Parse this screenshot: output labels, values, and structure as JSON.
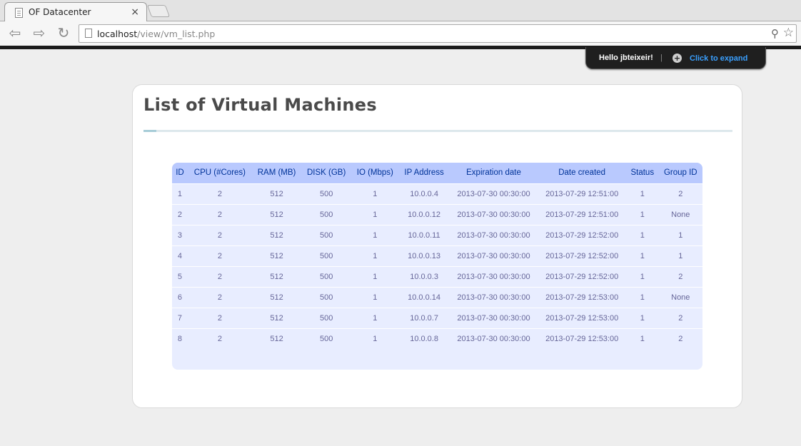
{
  "browser": {
    "tab_title": "OF Datacenter",
    "tab_close": "×",
    "url_host": "localhost",
    "url_path": "/view/vm_list.php"
  },
  "userbar": {
    "greeting": "Hello jbteixeir!",
    "separator": "|",
    "expand_label": "Click to expand"
  },
  "page": {
    "title": "List of Virtual Machines"
  },
  "table": {
    "headers": [
      "ID",
      "CPU (#Cores)",
      "RAM (MB)",
      "DISK (GB)",
      "IO (Mbps)",
      "IP Address",
      "Expiration date",
      "Date created",
      "Status",
      "Group ID"
    ],
    "rows": [
      [
        "1",
        "2",
        "512",
        "500",
        "1",
        "10.0.0.4",
        "2013-07-30 00:30:00",
        "2013-07-29 12:51:00",
        "1",
        "2"
      ],
      [
        "2",
        "2",
        "512",
        "500",
        "1",
        "10.0.0.12",
        "2013-07-30 00:30:00",
        "2013-07-29 12:51:00",
        "1",
        "None"
      ],
      [
        "3",
        "2",
        "512",
        "500",
        "1",
        "10.0.0.11",
        "2013-07-30 00:30:00",
        "2013-07-29 12:52:00",
        "1",
        "1"
      ],
      [
        "4",
        "2",
        "512",
        "500",
        "1",
        "10.0.0.13",
        "2013-07-30 00:30:00",
        "2013-07-29 12:52:00",
        "1",
        "1"
      ],
      [
        "5",
        "2",
        "512",
        "500",
        "1",
        "10.0.0.3",
        "2013-07-30 00:30:00",
        "2013-07-29 12:52:00",
        "1",
        "2"
      ],
      [
        "6",
        "2",
        "512",
        "500",
        "1",
        "10.0.0.14",
        "2013-07-30 00:30:00",
        "2013-07-29 12:53:00",
        "1",
        "None"
      ],
      [
        "7",
        "2",
        "512",
        "500",
        "1",
        "10.0.0.7",
        "2013-07-30 00:30:00",
        "2013-07-29 12:53:00",
        "1",
        "2"
      ],
      [
        "8",
        "2",
        "512",
        "500",
        "1",
        "10.0.0.8",
        "2013-07-30 00:30:00",
        "2013-07-29 12:53:00",
        "1",
        "2"
      ]
    ]
  },
  "colors": {
    "table_header_bg": "#b9c9fe",
    "table_header_text": "#003399",
    "table_row_bg": "#e8edff",
    "table_row_text": "#666699",
    "expand_link": "#3aa0ff"
  },
  "icons": {
    "tab": "page-icon",
    "back": "back-arrow-icon",
    "forward": "forward-arrow-icon",
    "reload": "reload-icon",
    "zoom": "magnifier-icon",
    "bookmark": "star-icon",
    "expand": "plus-circle-icon"
  }
}
